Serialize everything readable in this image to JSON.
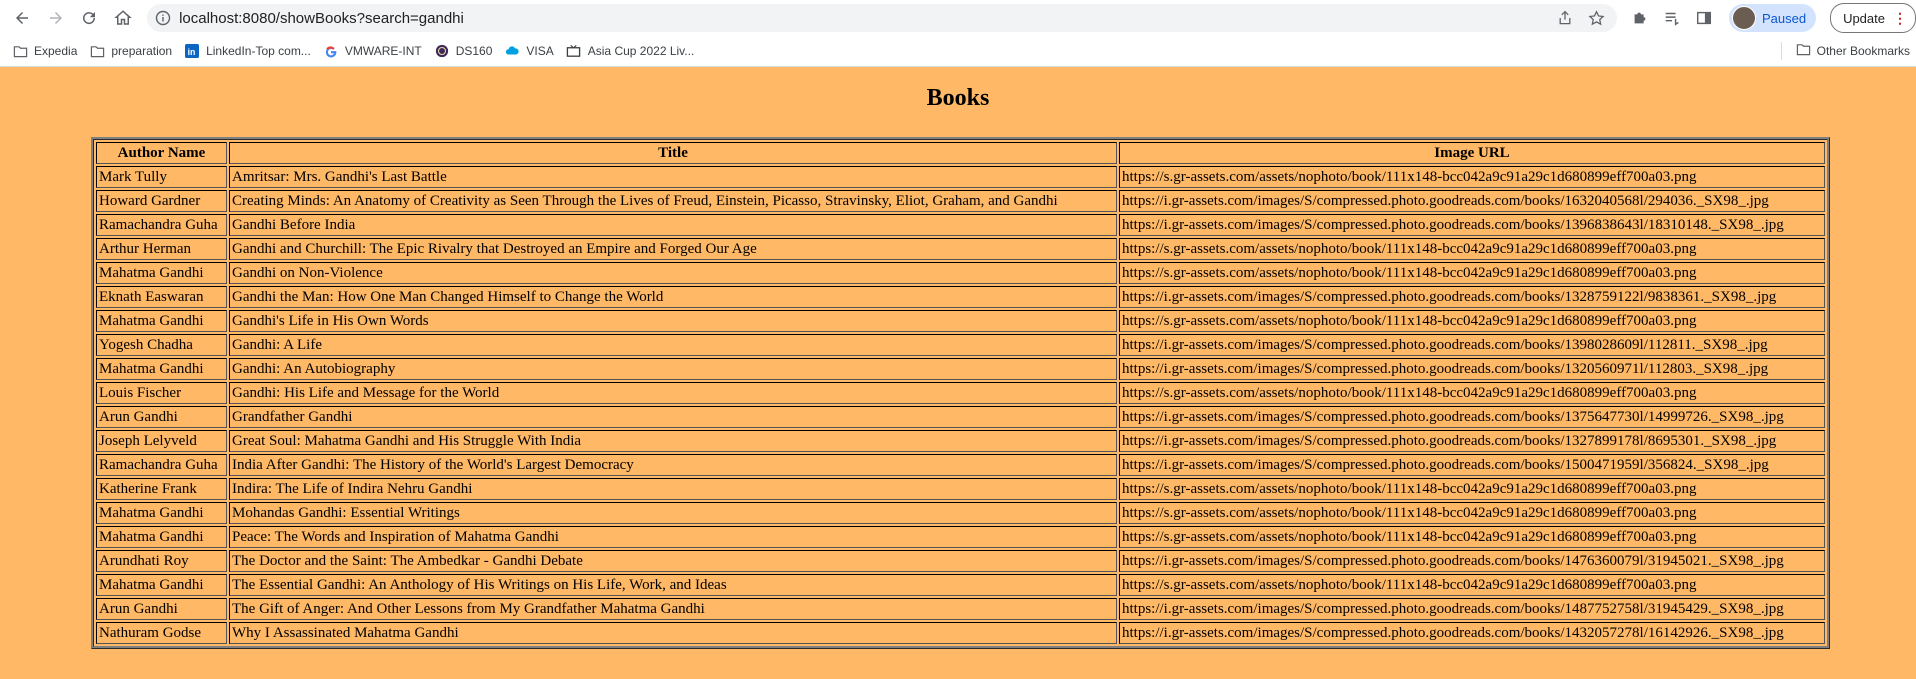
{
  "browser": {
    "url": "localhost:8080/showBooks?search=gandhi",
    "profile_status": "Paused",
    "update_label": "Update",
    "bookmarks": [
      {
        "label": "Expedia",
        "icon": "folder-icon"
      },
      {
        "label": "preparation",
        "icon": "folder-icon"
      },
      {
        "label": "LinkedIn-Top com...",
        "icon": "linkedin-icon"
      },
      {
        "label": "VMWARE-INT",
        "icon": "google-icon"
      },
      {
        "label": "DS160",
        "icon": "seal-icon"
      },
      {
        "label": "VISA",
        "icon": "cloud-icon"
      },
      {
        "label": "Asia Cup 2022 Liv...",
        "icon": "tv-icon"
      }
    ],
    "other_bookmarks": "Other Bookmarks"
  },
  "page": {
    "title": "Books",
    "columns": [
      "Author Name",
      "Title",
      "Image URL"
    ],
    "rows": [
      [
        "Mark Tully",
        "Amritsar: Mrs. Gandhi's Last Battle",
        "https://s.gr-assets.com/assets/nophoto/book/111x148-bcc042a9c91a29c1d680899eff700a03.png"
      ],
      [
        "Howard Gardner",
        "Creating Minds: An Anatomy of Creativity as Seen Through the Lives of Freud, Einstein, Picasso, Stravinsky, Eliot, Graham, and Gandhi",
        "https://i.gr-assets.com/images/S/compressed.photo.goodreads.com/books/1632040568l/294036._SX98_.jpg"
      ],
      [
        "Ramachandra Guha",
        "Gandhi Before India",
        "https://i.gr-assets.com/images/S/compressed.photo.goodreads.com/books/1396838643l/18310148._SX98_.jpg"
      ],
      [
        "Arthur Herman",
        "Gandhi and Churchill: The Epic Rivalry that Destroyed an Empire and Forged Our Age",
        "https://s.gr-assets.com/assets/nophoto/book/111x148-bcc042a9c91a29c1d680899eff700a03.png"
      ],
      [
        "Mahatma Gandhi",
        "Gandhi on Non-Violence",
        "https://s.gr-assets.com/assets/nophoto/book/111x148-bcc042a9c91a29c1d680899eff700a03.png"
      ],
      [
        "Eknath Easwaran",
        "Gandhi the Man: How One Man Changed Himself to Change the World",
        "https://i.gr-assets.com/images/S/compressed.photo.goodreads.com/books/1328759122l/9838361._SX98_.jpg"
      ],
      [
        "Mahatma Gandhi",
        "Gandhi's Life in His Own Words",
        "https://s.gr-assets.com/assets/nophoto/book/111x148-bcc042a9c91a29c1d680899eff700a03.png"
      ],
      [
        "Yogesh Chadha",
        "Gandhi: A Life",
        "https://i.gr-assets.com/images/S/compressed.photo.goodreads.com/books/1398028609l/112811._SX98_.jpg"
      ],
      [
        "Mahatma Gandhi",
        "Gandhi: An Autobiography",
        "https://i.gr-assets.com/images/S/compressed.photo.goodreads.com/books/1320560971l/112803._SX98_.jpg"
      ],
      [
        "Louis Fischer",
        "Gandhi: His Life and Message for the World",
        "https://s.gr-assets.com/assets/nophoto/book/111x148-bcc042a9c91a29c1d680899eff700a03.png"
      ],
      [
        "Arun Gandhi",
        "Grandfather Gandhi",
        "https://i.gr-assets.com/images/S/compressed.photo.goodreads.com/books/1375647730l/14999726._SX98_.jpg"
      ],
      [
        "Joseph Lelyveld",
        "Great Soul: Mahatma Gandhi and His Struggle With India",
        "https://i.gr-assets.com/images/S/compressed.photo.goodreads.com/books/1327899178l/8695301._SX98_.jpg"
      ],
      [
        "Ramachandra Guha",
        "India After Gandhi: The History of the World's Largest Democracy",
        "https://i.gr-assets.com/images/S/compressed.photo.goodreads.com/books/1500471959l/356824._SX98_.jpg"
      ],
      [
        "Katherine Frank",
        "Indira: The Life of Indira Nehru Gandhi",
        "https://s.gr-assets.com/assets/nophoto/book/111x148-bcc042a9c91a29c1d680899eff700a03.png"
      ],
      [
        "Mahatma Gandhi",
        "Mohandas Gandhi: Essential Writings",
        "https://s.gr-assets.com/assets/nophoto/book/111x148-bcc042a9c91a29c1d680899eff700a03.png"
      ],
      [
        "Mahatma Gandhi",
        "Peace: The Words and Inspiration of Mahatma Gandhi",
        "https://s.gr-assets.com/assets/nophoto/book/111x148-bcc042a9c91a29c1d680899eff700a03.png"
      ],
      [
        "Arundhati Roy",
        "The Doctor and the Saint: The Ambedkar - Gandhi Debate",
        "https://i.gr-assets.com/images/S/compressed.photo.goodreads.com/books/1476360079l/31945021._SX98_.jpg"
      ],
      [
        "Mahatma Gandhi",
        "The Essential Gandhi: An Anthology of His Writings on His Life, Work, and Ideas",
        "https://s.gr-assets.com/assets/nophoto/book/111x148-bcc042a9c91a29c1d680899eff700a03.png"
      ],
      [
        "Arun Gandhi",
        "The Gift of Anger: And Other Lessons from My Grandfather Mahatma Gandhi",
        "https://i.gr-assets.com/images/S/compressed.photo.goodreads.com/books/1487752758l/31945429._SX98_.jpg"
      ],
      [
        "Nathuram Godse",
        "Why I Assassinated Mahatma Gandhi",
        "https://i.gr-assets.com/images/S/compressed.photo.goodreads.com/books/1432057278l/16142926._SX98_.jpg"
      ]
    ]
  },
  "colors": {
    "page_background": "#ffb866",
    "chrome_background": "#ffffff",
    "omnibox_background": "#f1f3f4",
    "profile_pill": "#d3e3fd"
  }
}
